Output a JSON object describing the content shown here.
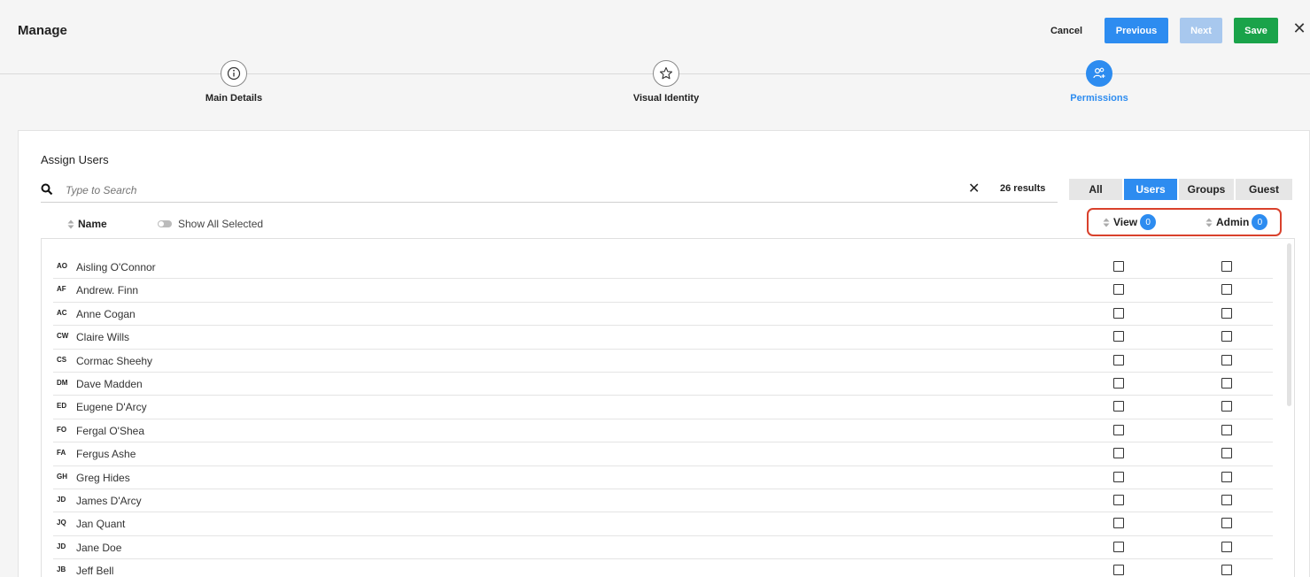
{
  "header": {
    "title": "Manage",
    "cancel_label": "Cancel",
    "previous_label": "Previous",
    "next_label": "Next",
    "save_label": "Save",
    "close_glyph": "✕"
  },
  "steps": [
    {
      "label": "Main Details",
      "icon": "info-icon",
      "active": false
    },
    {
      "label": "Visual Identity",
      "icon": "star-icon",
      "active": false
    },
    {
      "label": "Permissions",
      "icon": "users-icon",
      "active": true
    }
  ],
  "assign": {
    "title": "Assign Users",
    "search_placeholder": "Type to Search",
    "clear_glyph": "✕",
    "results": "26 results",
    "tabs": [
      {
        "label": "All",
        "active": false
      },
      {
        "label": "Users",
        "active": true
      },
      {
        "label": "Groups",
        "active": false
      },
      {
        "label": "Guest",
        "active": false
      }
    ],
    "name_header": "Name",
    "show_all_selected": "Show All Selected",
    "view_header": "View",
    "view_count": "0",
    "admin_header": "Admin",
    "admin_count": "0"
  },
  "users": [
    {
      "initials": "AO",
      "name": "Aisling O'Connor"
    },
    {
      "initials": "AF",
      "name": "Andrew. Finn"
    },
    {
      "initials": "AC",
      "name": "Anne Cogan"
    },
    {
      "initials": "CW",
      "name": "Claire Wills"
    },
    {
      "initials": "CS",
      "name": "Cormac Sheehy"
    },
    {
      "initials": "DM",
      "name": "Dave Madden"
    },
    {
      "initials": "ED",
      "name": "Eugene D'Arcy"
    },
    {
      "initials": "FO",
      "name": "Fergal O'Shea"
    },
    {
      "initials": "FA",
      "name": "Fergus Ashe"
    },
    {
      "initials": "GH",
      "name": "Greg Hides"
    },
    {
      "initials": "JD",
      "name": "James D'Arcy"
    },
    {
      "initials": "JQ",
      "name": "Jan Quant"
    },
    {
      "initials": "JD",
      "name": "Jane Doe"
    },
    {
      "initials": "JB",
      "name": "Jeff Bell"
    }
  ],
  "colors": {
    "accent": "#2d8cf0",
    "save": "#1aa34a",
    "highlight": "#d9412c"
  }
}
